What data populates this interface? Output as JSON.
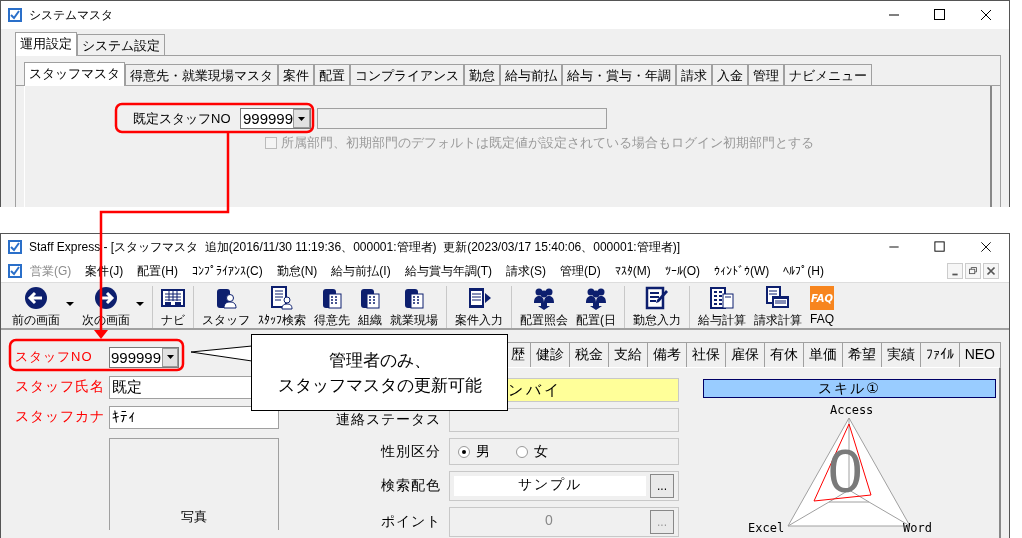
{
  "system_window": {
    "title": "システムマスタ",
    "outer_tabs": [
      {
        "label": "運用設定",
        "selected": true
      },
      {
        "label": "システム設定",
        "selected": false
      }
    ],
    "inner_tabs": [
      {
        "label": "スタッフマスタ",
        "selected": true
      },
      {
        "label": "得意先・就業現場マスタ",
        "selected": false
      },
      {
        "label": "案件",
        "selected": false
      },
      {
        "label": "配置",
        "selected": false
      },
      {
        "label": "コンプライアンス",
        "selected": false
      },
      {
        "label": "勤怠",
        "selected": false
      },
      {
        "label": "給与前払",
        "selected": false
      },
      {
        "label": "給与・賞与・年調",
        "selected": false
      },
      {
        "label": "請求",
        "selected": false
      },
      {
        "label": "入金",
        "selected": false
      },
      {
        "label": "管理",
        "selected": false
      },
      {
        "label": "ナビメニュー",
        "selected": false
      }
    ],
    "default_staff_no": {
      "label": "既定スタッフNO",
      "value": "999999"
    },
    "option": {
      "label": "所属部門、初期部門のデフォルトは既定値が設定されている場合もログイン初期部門とする",
      "checked": false,
      "disabled": true
    }
  },
  "main_window": {
    "title": "Staff Express - [スタッフマスタ  追加(2016/11/30 11:19:36、000001:管理者)  更新(2023/03/17 15:40:06、000001:管理者)]",
    "menu": [
      {
        "label": "営業(G)",
        "disabled": true
      },
      {
        "label": "案件(J)",
        "disabled": false
      },
      {
        "label": "配置(H)",
        "disabled": false
      },
      {
        "label": "ｺﾝﾌﾟﾗｲｱﾝｽ(C)",
        "disabled": false
      },
      {
        "label": "勤怠(N)",
        "disabled": false
      },
      {
        "label": "給与前払(I)",
        "disabled": false
      },
      {
        "label": "給与賞与年調(T)",
        "disabled": false
      },
      {
        "label": "請求(S)",
        "disabled": false
      },
      {
        "label": "管理(D)",
        "disabled": false
      },
      {
        "label": "ﾏｽﾀ(M)",
        "disabled": false
      },
      {
        "label": "ﾂｰﾙ(O)",
        "disabled": false
      },
      {
        "label": "ｳｨﾝﾄﾞｳ(W)",
        "disabled": false
      },
      {
        "label": "ﾍﾙﾌﾟ(H)",
        "disabled": false
      }
    ],
    "toolbar": [
      {
        "items": [
          {
            "label": "前の画面",
            "dropdown": true
          },
          {
            "label": "次の画面",
            "dropdown": true
          }
        ]
      },
      {
        "items": [
          {
            "label": "ナビ",
            "dropdown": false
          }
        ]
      },
      {
        "items": [
          {
            "label": "スタッフ",
            "dropdown": false
          },
          {
            "label": "ｽﾀｯﾌ検索",
            "dropdown": false
          },
          {
            "label": "得意先",
            "dropdown": false
          },
          {
            "label": "組織",
            "dropdown": false
          },
          {
            "label": "就業現場",
            "dropdown": false
          }
        ]
      },
      {
        "items": [
          {
            "label": "案件入力",
            "dropdown": false
          }
        ]
      },
      {
        "items": [
          {
            "label": "配置照会",
            "dropdown": false
          },
          {
            "label": "配置(日",
            "dropdown": false
          }
        ]
      },
      {
        "items": [
          {
            "label": "勤怠入力",
            "dropdown": false
          }
        ]
      },
      {
        "items": [
          {
            "label": "給与計算",
            "dropdown": false
          },
          {
            "label": "請求計算",
            "dropdown": false
          },
          {
            "label": "FAQ",
            "badge": "FAQ",
            "dropdown": false
          }
        ]
      }
    ],
    "tabs": [
      {
        "label": "歴",
        "selected": false
      },
      {
        "label": "健診",
        "selected": false
      },
      {
        "label": "税金",
        "selected": false
      },
      {
        "label": "支給",
        "selected": false
      },
      {
        "label": "備考",
        "selected": false
      },
      {
        "label": "社保",
        "selected": false
      },
      {
        "label": "雇保",
        "selected": false
      },
      {
        "label": "有休",
        "selected": false
      },
      {
        "label": "単価",
        "selected": false
      },
      {
        "label": "希望",
        "selected": false
      },
      {
        "label": "実績",
        "selected": false
      },
      {
        "label": "ﾌｧｲﾙ",
        "selected": false
      },
      {
        "label": "NEO",
        "selected": false
      }
    ],
    "staff_fields": [
      {
        "label": "スタッフNO",
        "value": "999999",
        "kind": "combo"
      },
      {
        "label": "スタッフ氏名",
        "value": "既定",
        "kind": "text"
      },
      {
        "label": "スタッフカナ",
        "value": "ｷﾃｨ",
        "kind": "text"
      }
    ],
    "photo": {
      "label": "写真"
    },
    "detail_rows": [
      {
        "kind": "highlight",
        "value": "ンバイ"
      },
      {
        "kind": "text",
        "label": "連絡ステータス"
      },
      {
        "kind": "radio",
        "label": "性別区分",
        "options": [
          {
            "label": "男",
            "selected": true
          },
          {
            "label": "女",
            "selected": false
          }
        ]
      },
      {
        "kind": "picker",
        "label": "検索配色",
        "value": "サンプル",
        "button": "...",
        "disabled": false
      },
      {
        "kind": "picker",
        "label": "ポイント",
        "value": "0",
        "button": "...",
        "disabled": true
      }
    ],
    "skill": {
      "title": "スキル①",
      "score": "0",
      "axes": [
        "Access",
        "Excel",
        "Word"
      ]
    }
  },
  "callout": {
    "lines": [
      "管理者のみ、",
      "スタッフマスタの更新可能"
    ]
  }
}
